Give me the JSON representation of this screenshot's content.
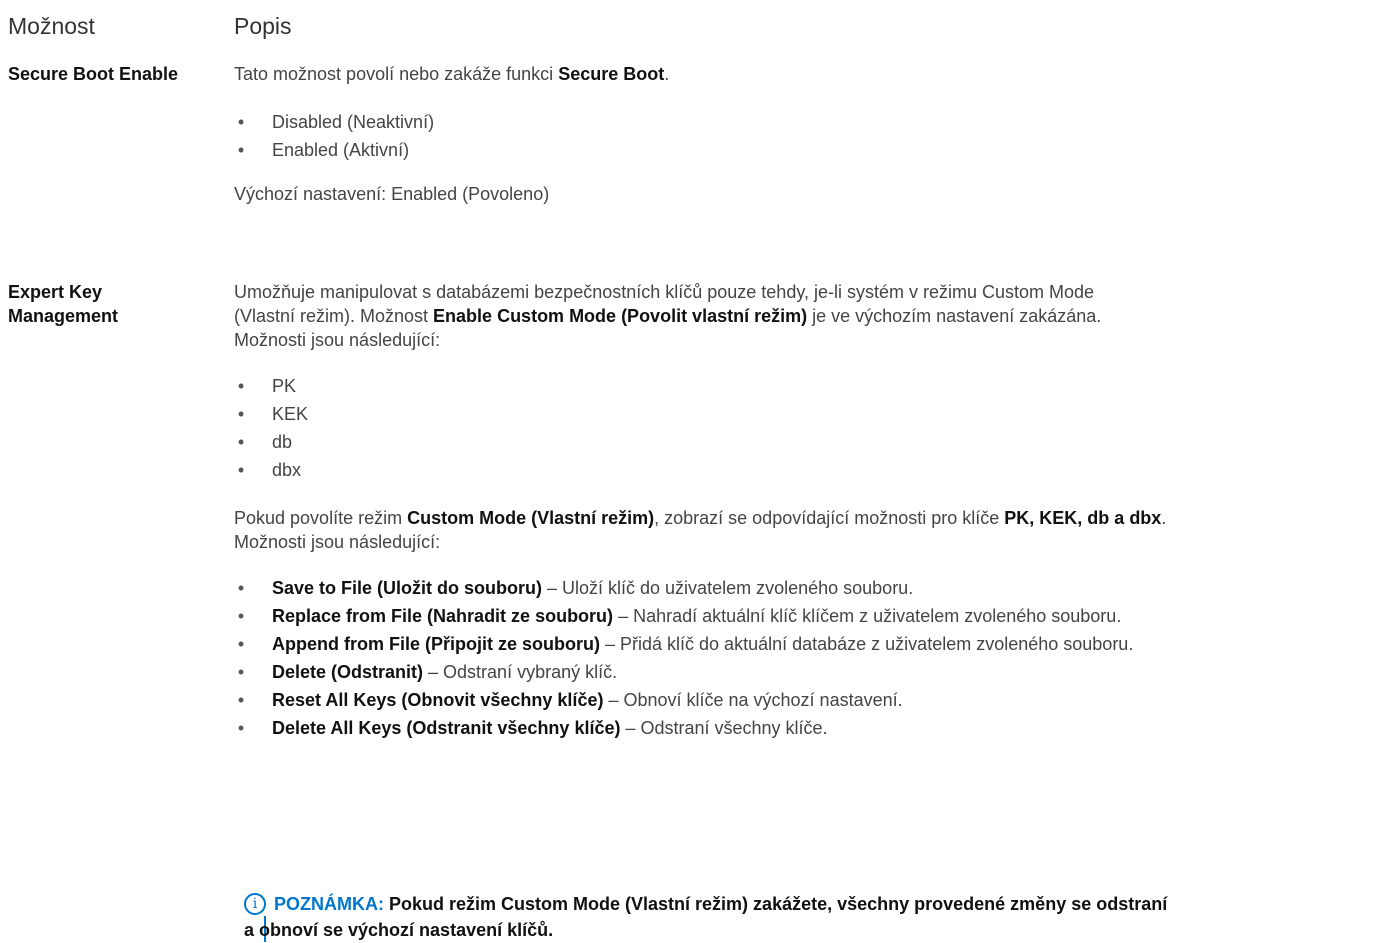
{
  "header": {
    "col1": "Možnost",
    "col2": "Popis"
  },
  "secure_boot": {
    "label": "Secure Boot Enable",
    "desc_pre": "Tato možnost povolí nebo zakáže funkci ",
    "desc_bold": "Secure Boot",
    "desc_post": ".",
    "options": [
      "Disabled (Neaktivní)",
      "Enabled (Aktivní)"
    ],
    "default": "Výchozí nastavení: Enabled (Povoleno)"
  },
  "expert_key": {
    "label_line1": "Expert Key",
    "label_line2": "Management",
    "p1_line1": "Umožňuje manipulovat s databázemi bezpečnostních klíčů pouze tehdy, je-li systém v režimu Custom Mode",
    "p1_line2_pre": "(Vlastní režim). Možnost ",
    "p1_line2_bold": "Enable Custom Mode (Povolit vlastní režim)",
    "p1_line2_post": " je ve výchozím nastavení zakázána.",
    "p1_line3": "Možnosti jsou následující:",
    "keys": [
      "PK",
      "KEK",
      "db",
      "dbx"
    ],
    "p2_pre": "Pokud povolíte režim ",
    "p2_bold1": "Custom Mode (Vlastní režim)",
    "p2_mid": ", zobrazí se odpovídající možnosti pro klíče ",
    "p2_bold2": "PK, KEK, db a dbx",
    "p2_post": ".",
    "p2_line2": "Možnosti jsou následující:",
    "actions": [
      {
        "name": "Save to File (Uložit do souboru)",
        "desc": " – Uloží klíč do uživatelem zvoleného souboru."
      },
      {
        "name": "Replace from File (Nahradit ze souboru)",
        "desc": " – Nahradí aktuální klíč klíčem z uživatelem zvoleného souboru."
      },
      {
        "name": "Append from File (Připojit ze souboru)",
        "desc": " – Přidá klíč do aktuální databáze z uživatelem zvoleného souboru."
      },
      {
        "name": "Delete (Odstranit)",
        "desc": " – Odstraní vybraný klíč."
      },
      {
        "name": "Reset All Keys (Obnovit všechny klíče)",
        "desc": " – Obnoví klíče na výchozí nastavení."
      },
      {
        "name": "Delete All Keys (Odstranit všechny klíče)",
        "desc": " – Odstraní všechny klíče."
      }
    ]
  },
  "note": {
    "icon": "info-icon",
    "icon_glyph": "i",
    "label": "POZNÁMKA:",
    "line1": " Pokud režim Custom Mode (Vlastní režim) zakážete, všechny provedené změny se odstraní",
    "line2": "a obnoví se výchozí nastavení klíčů.",
    "accent_color": "#0076ce"
  }
}
